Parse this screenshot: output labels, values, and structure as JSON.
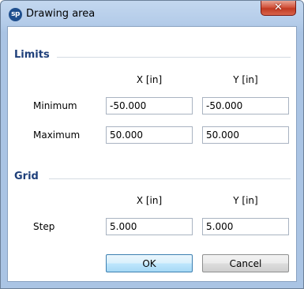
{
  "window": {
    "title": "Drawing area",
    "app_icon_text": "sp",
    "close_glyph": "✕"
  },
  "limits": {
    "title": "Limits",
    "col_x": "X [in]",
    "col_y": "Y [in]",
    "rows": [
      {
        "label": "Minimum",
        "x": "-50.000",
        "y": "-50.000"
      },
      {
        "label": "Maximum",
        "x": "50.000",
        "y": "50.000"
      }
    ]
  },
  "grid": {
    "title": "Grid",
    "col_x": "X [in]",
    "col_y": "Y [in]",
    "rows": [
      {
        "label": "Step",
        "x": "5.000",
        "y": "5.000"
      }
    ]
  },
  "buttons": {
    "ok": "OK",
    "cancel": "Cancel"
  }
}
